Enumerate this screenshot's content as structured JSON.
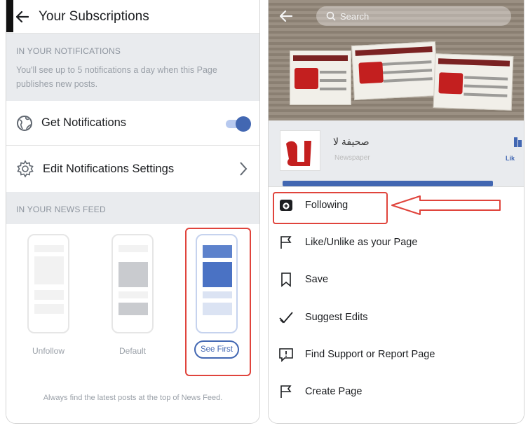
{
  "left": {
    "header_title": "Your Subscriptions",
    "notifications": {
      "heading": "IN YOUR NOTIFICATIONS",
      "subtext": "You'll see up to 5 notifications a day when this Page publishes new posts.",
      "get_label": "Get Notifications",
      "get_enabled": true,
      "edit_label": "Edit Notifications Settings"
    },
    "news_feed": {
      "heading": "IN YOUR NEWS FEED",
      "options": [
        "Unfollow",
        "Default",
        "See First"
      ],
      "selected": "See First",
      "footer": "Always find the latest posts at the top of News Feed."
    }
  },
  "right": {
    "search_placeholder": "Search",
    "page": {
      "name": "صحيفة لا",
      "category": "Newspaper",
      "like_label": "Lik"
    },
    "menu": [
      {
        "icon": "following-icon",
        "label": "Following"
      },
      {
        "icon": "flag-icon",
        "label": "Like/Unlike as your Page"
      },
      {
        "icon": "bookmark-icon",
        "label": "Save"
      },
      {
        "icon": "check-icon",
        "label": "Suggest Edits"
      },
      {
        "icon": "report-icon",
        "label": "Find Support or Report Page"
      },
      {
        "icon": "flag-icon",
        "label": "Create Page"
      }
    ]
  },
  "colors": {
    "accent": "#4267b2",
    "highlight": "#e0443c",
    "section_bg": "#e9ebee"
  }
}
